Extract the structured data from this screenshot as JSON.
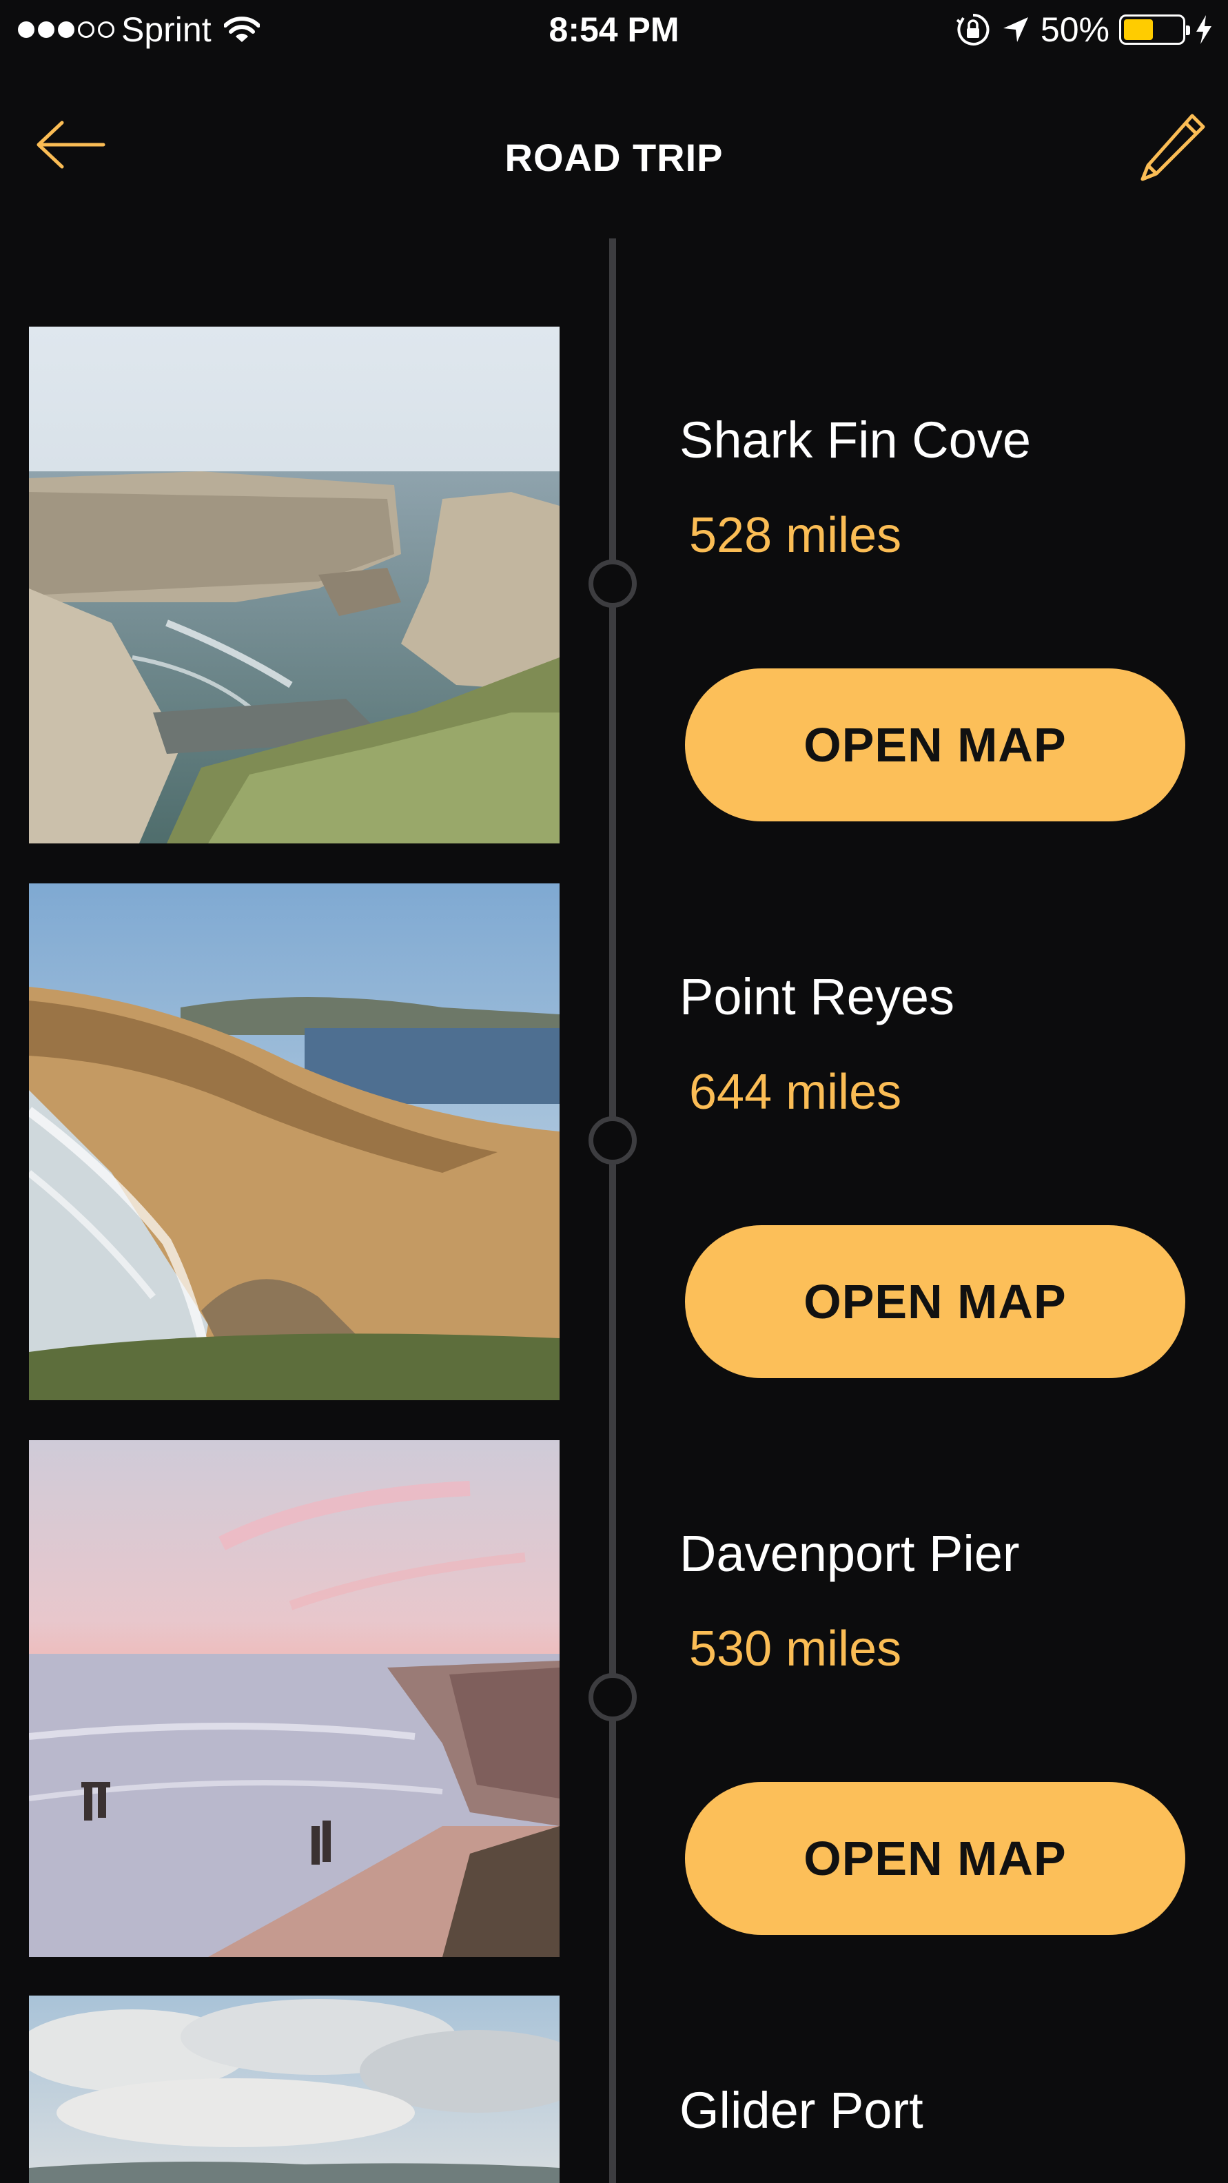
{
  "status_bar": {
    "carrier": "Sprint",
    "time": "8:54 PM",
    "battery": "50%",
    "battery_level": 0.5,
    "signal_bars_filled": 3,
    "signal_bars_total": 5
  },
  "nav": {
    "title": "ROAD TRIP",
    "back_icon": "arrow-left-icon",
    "edit_icon": "pencil-icon"
  },
  "colors": {
    "background": "#0c0c0d",
    "accent": "#fcbf59",
    "distance_text": "#fbbd55",
    "timeline": "#3d3d40"
  },
  "trips": [
    {
      "name": "Shark Fin Cove",
      "distance": "528 miles",
      "button": "OPEN MAP"
    },
    {
      "name": "Point Reyes",
      "distance": "644 miles",
      "button": "OPEN MAP"
    },
    {
      "name": "Davenport Pier",
      "distance": "530 miles",
      "button": "OPEN MAP"
    },
    {
      "name": "Glider Port"
    }
  ]
}
